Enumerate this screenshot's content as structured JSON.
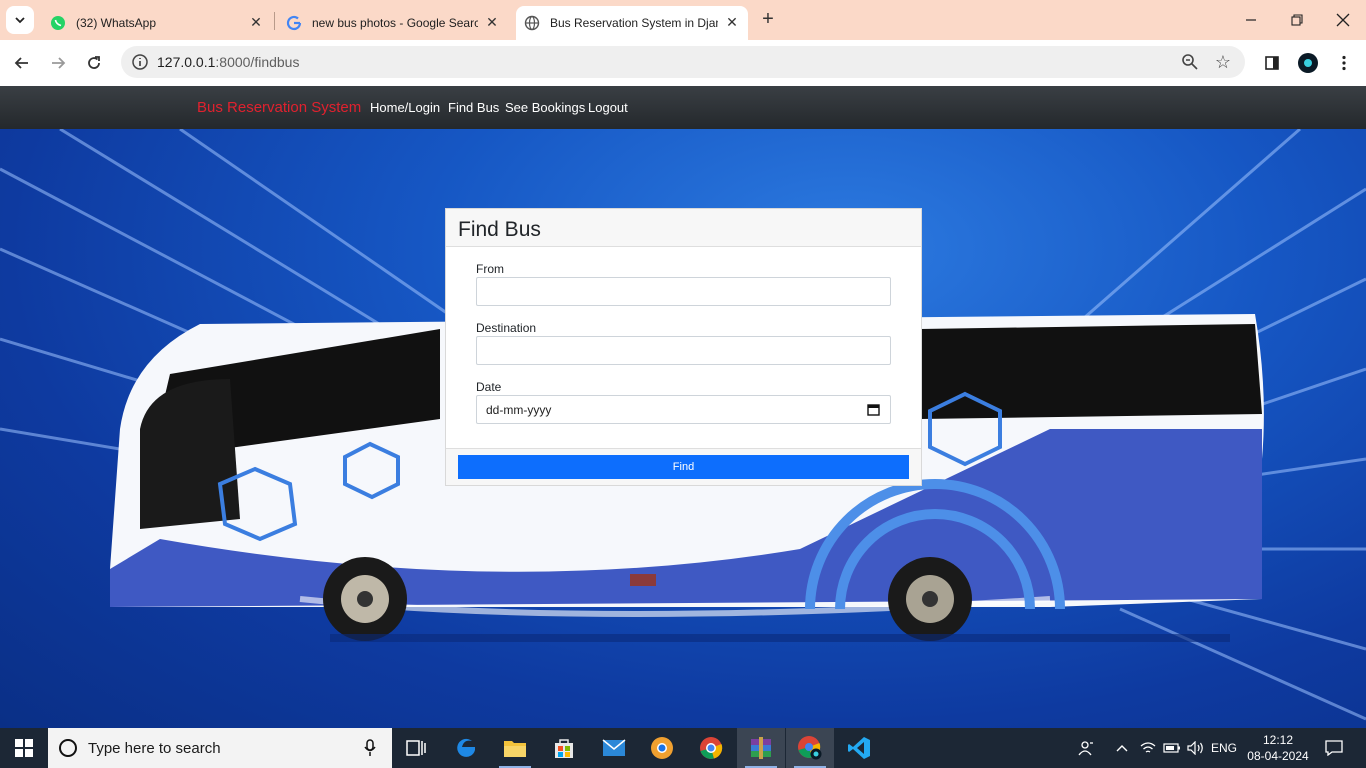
{
  "browser": {
    "tabs": [
      {
        "title": "(32) WhatsApp",
        "icon": "whatsapp-icon"
      },
      {
        "title": "new bus photos - Google Searc",
        "icon": "google-icon"
      },
      {
        "title": "Bus Reservation System in Djan",
        "icon": "globe-icon"
      }
    ],
    "url_host": "127.0.0.1",
    "url_path": ":8000/findbus"
  },
  "site": {
    "brand": "Bus Reservation System",
    "nav": [
      "Home/Login",
      "Find Bus",
      "See Bookings",
      "Logout"
    ]
  },
  "form": {
    "title": "Find Bus",
    "from_label": "From",
    "destination_label": "Destination",
    "date_label": "Date",
    "date_placeholder": "dd-mm-yyyy",
    "submit_label": "Find"
  },
  "taskbar": {
    "search_placeholder": "Type here to search",
    "language": "ENG",
    "time": "12:12",
    "date": "08-04-2024"
  },
  "colors": {
    "brand": "#e0212e",
    "primary_button": "#0d6efd",
    "tab_strip": "#fbd9c8"
  }
}
